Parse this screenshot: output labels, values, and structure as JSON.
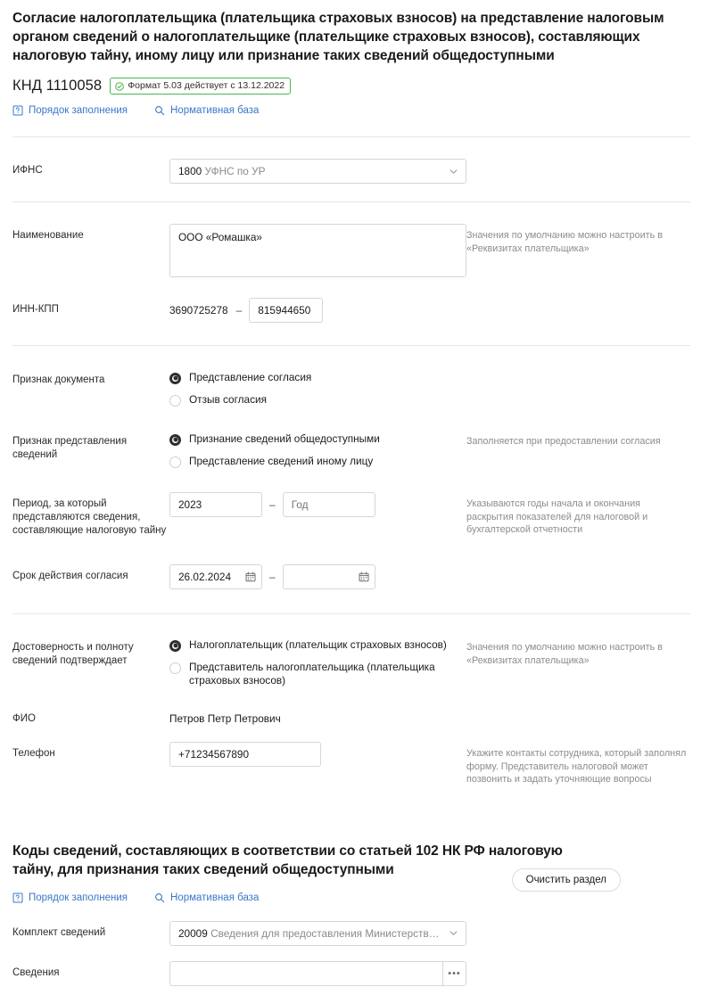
{
  "document": {
    "title": "Согласие налогоплательщика (плательщика страховых взносов) на представление налоговым органом сведений о налогоплательщике (плательщике страховых взносов), составляющих налоговую тайну, иному лицу или признание таких сведений общедоступными",
    "knd_code": "КНД 1110058",
    "format_badge": "Формат 5.03 действует с 13.12.2022",
    "accent_green": "#49b749",
    "accent_link": "#3878c8"
  },
  "links": {
    "fill_order": "Порядок заполнения",
    "legal_base": "Нормативная база"
  },
  "fields": {
    "ifns": {
      "label": "ИФНС",
      "value_code": "1800",
      "value_rest": "УФНС по УР"
    },
    "name": {
      "label": "Наименование",
      "value": "ООО «Ромашка»",
      "hint": "Значения по умолчанию можно настроить в «Реквизитах плательщика»"
    },
    "inn_kpp": {
      "label": "ИНН-КПП",
      "inn": "3690725278",
      "separator": "–",
      "kpp": "815944650"
    },
    "doc_sign": {
      "label": "Признак документа",
      "options": [
        {
          "label": "Представление согласия",
          "checked": true
        },
        {
          "label": "Отзыв согласия",
          "checked": false
        }
      ]
    },
    "info_sign": {
      "label": "Признак представления сведений",
      "options": [
        {
          "label": "Признание сведений общедоступными",
          "checked": true
        },
        {
          "label": "Представление сведений иному лицу",
          "checked": false
        }
      ],
      "hint": "Заполняется при предоставлении согласия"
    },
    "period": {
      "label": "Период, за который представляются сведения, составляющие налоговую тайну",
      "from_value": "2023",
      "separator": "–",
      "to_placeholder": "Год",
      "to_value": "",
      "hint": "Указываются годы начала и окончания раскрытия показателей для налоговой и бухгалтерской отчетности"
    },
    "validity": {
      "label": "Срок действия согласия",
      "from_value": "26.02.2024",
      "separator": "–",
      "to_value": ""
    },
    "confirm": {
      "label": "Достоверность и полноту сведений подтверждает",
      "options": [
        {
          "label": "Налогоплательщик (плательщик страховых взносов)",
          "checked": true
        },
        {
          "label": "Представитель налогоплательщика (плательщика страховых взносов)",
          "checked": false
        }
      ],
      "hint": "Значения по умолчанию можно настроить в «Реквизитах плательщика»"
    },
    "fio": {
      "label": "ФИО",
      "value": "Петров Петр Петрович"
    },
    "phone": {
      "label": "Телефон",
      "value": "+71234567890",
      "hint": "Укажите контакты сотрудника, который заполнял форму. Представитель налоговой может позвонить и задать уточняющие вопросы"
    }
  },
  "section2": {
    "title": "Коды сведений, составляющих в соответствии со статьей 102 НК РФ налоговую тайну, для признания таких сведений общедоступными",
    "clear_button": "Очистить раздел",
    "kit": {
      "label": "Комплект сведений",
      "value_code": "20009",
      "value_rest": "Сведения для предоставления Министерств…"
    },
    "info": {
      "label": "Сведения",
      "value": "",
      "ellipsis_button": "•••"
    }
  }
}
